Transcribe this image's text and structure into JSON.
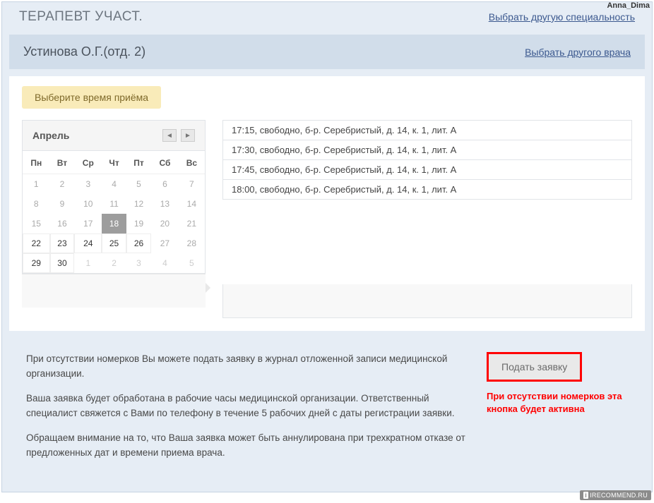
{
  "watermark": "Anna_Dima",
  "irecommend": "IRECOMMEND.RU",
  "header": {
    "specialty": "ТЕРАПЕВТ УЧАСТ.",
    "change_specialty": "Выбрать другую специальность"
  },
  "doctor": {
    "name": "Устинова О.Г.(отд. 2)",
    "change_doctor": "Выбрать другого врача"
  },
  "select_time_label": "Выберите время приёма",
  "calendar": {
    "month": "Апрель",
    "prev": "◄",
    "next": "►",
    "weekdays": [
      "Пн",
      "Вт",
      "Ср",
      "Чт",
      "Пт",
      "Сб",
      "Вс"
    ],
    "weeks": [
      [
        {
          "d": "1",
          "c": "past"
        },
        {
          "d": "2",
          "c": "past"
        },
        {
          "d": "3",
          "c": "past"
        },
        {
          "d": "4",
          "c": "past"
        },
        {
          "d": "5",
          "c": "past"
        },
        {
          "d": "6",
          "c": "past"
        },
        {
          "d": "7",
          "c": "past"
        }
      ],
      [
        {
          "d": "8",
          "c": "past"
        },
        {
          "d": "9",
          "c": "past"
        },
        {
          "d": "10",
          "c": "past"
        },
        {
          "d": "11",
          "c": "past"
        },
        {
          "d": "12",
          "c": "past"
        },
        {
          "d": "13",
          "c": "past"
        },
        {
          "d": "14",
          "c": "past"
        }
      ],
      [
        {
          "d": "15",
          "c": "past"
        },
        {
          "d": "16",
          "c": "past"
        },
        {
          "d": "17",
          "c": "past"
        },
        {
          "d": "18",
          "c": "sel"
        },
        {
          "d": "19",
          "c": "past"
        },
        {
          "d": "20",
          "c": "past"
        },
        {
          "d": "21",
          "c": "past"
        }
      ],
      [
        {
          "d": "22",
          "c": "avail"
        },
        {
          "d": "23",
          "c": "avail"
        },
        {
          "d": "24",
          "c": "avail"
        },
        {
          "d": "25",
          "c": "avail"
        },
        {
          "d": "26",
          "c": "avail"
        },
        {
          "d": "27",
          "c": "past"
        },
        {
          "d": "28",
          "c": "past"
        }
      ],
      [
        {
          "d": "29",
          "c": "avail"
        },
        {
          "d": "30",
          "c": "avail"
        },
        {
          "d": "1",
          "c": "next"
        },
        {
          "d": "2",
          "c": "next"
        },
        {
          "d": "3",
          "c": "next"
        },
        {
          "d": "4",
          "c": "next"
        },
        {
          "d": "5",
          "c": "next"
        }
      ]
    ]
  },
  "slots": [
    "17:15, свободно, б-р. Серебристый, д. 14, к. 1, лит. А",
    "17:30, свободно, б-р. Серебристый, д. 14, к. 1, лит. А",
    "17:45, свободно, б-р. Серебристый, д. 14, к. 1, лит. А",
    "18:00, свободно, б-р. Серебристый, д. 14, к. 1, лит. А"
  ],
  "info": {
    "p1": "При отсутствии номерков Вы можете подать заявку в журнал отложенной записи медицинской организации.",
    "p2": "Ваша заявка будет обработана в рабочие часы медицинской организации. Ответственный специалист свяжется с Вами по телефону в течение 5 рабочих дней с даты регистрации заявки.",
    "p3": "Обращаем внимание на то, что Ваша заявка может быть аннулирована при трехкратном отказе от предложенных дат и времени приема врача.",
    "submit": "Подать заявку",
    "red_note": "При отсутствии номерков эта кнопка будет активна"
  }
}
